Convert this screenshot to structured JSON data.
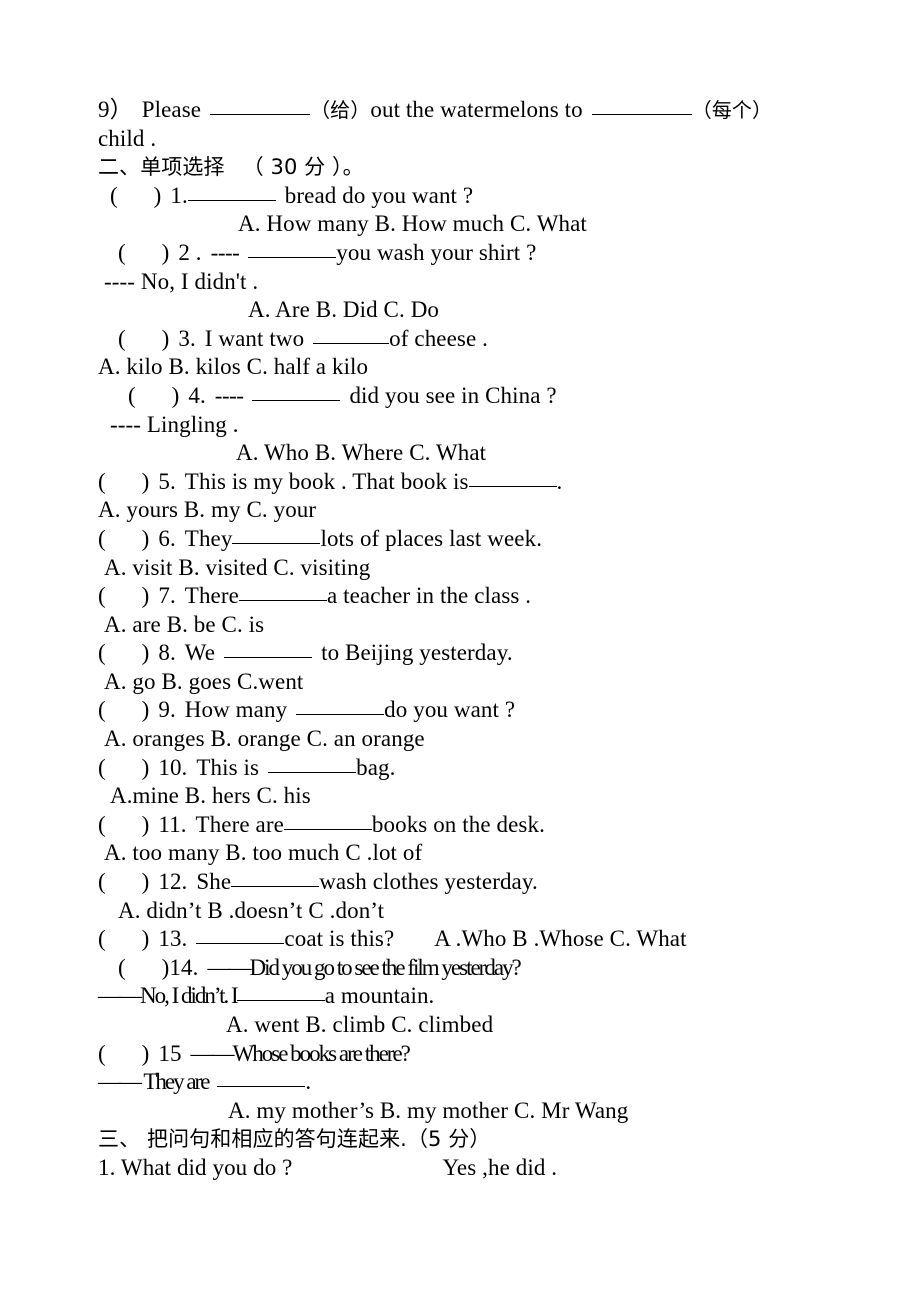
{
  "document": {
    "type": "english-exam-worksheet",
    "language": "en-zh",
    "fill_blank_marker": "__________"
  },
  "carryover_item": {
    "number": "9）",
    "text_1": "Please",
    "hint_1": "（给）",
    "text_2": "out the watermelons to",
    "hint_2": "（每个）",
    "text_3": "child .",
    "line1": "9）Please __________（给）out the watermelons to __________（每个）",
    "line2": "child ."
  },
  "section_two": {
    "heading": "二、单项选择  （ 30 分 ）。",
    "heading_label": "二、单项选择",
    "points": "（ 30 分 ）。",
    "questions": [
      {
        "num": "1.",
        "stem_pre": "",
        "stem_post": "bread  do  you  want ?",
        "options_line": "A.  How  many    B. How  much     C. What",
        "options": [
          "A.  How  many",
          "B. How  much",
          "C. What"
        ]
      },
      {
        "num": "2 .",
        "stem_pre": "----",
        "stem_post": "you  wash  your shirt ?",
        "reply": "---- No,  I  didn't .",
        "options_line": "A.  Are B.  Did    C.  Do",
        "options": [
          "A.  Are",
          "B.  Did",
          "C.  Do"
        ]
      },
      {
        "num": "3.",
        "stem_pre": "I  want  two",
        "stem_post": "of  cheese .",
        "options_line": "A.  kilo  B.  kilos  C.  half a kilo",
        "options": [
          "A.  kilo",
          "B.  kilos",
          "C.  half a kilo"
        ]
      },
      {
        "num": "4.",
        "stem_pre": "----",
        "stem_post": "did  you  see  in  China ?",
        "reply": "---- Lingling .",
        "options_line": "A.  Who      B.  Where      C.  What",
        "options": [
          "A.  Who",
          "B.  Where",
          "C.  What"
        ]
      },
      {
        "num": "5.",
        "stem_pre": "This  is  my  book .  That  book  is",
        "stem_post": ".",
        "options_line": "A. yours B.  my  C.  your",
        "options": [
          "A. yours",
          "B.  my",
          "C.  your"
        ]
      },
      {
        "num": "6.",
        "stem_pre": "They",
        "stem_post": "lots  of  places  last  week.",
        "options_line": "A. visit B.  visited C.  visiting",
        "options": [
          "A. visit",
          "B.  visited",
          "C.  visiting"
        ]
      },
      {
        "num": "7.",
        "stem_pre": "There",
        "stem_post": "a  teacher  in  the  class .",
        "options_line": "A. are  B.  be  C.  is",
        "options": [
          "A. are",
          "B.  be",
          "C.  is"
        ]
      },
      {
        "num": "8.",
        "stem_pre": "We",
        "stem_post": "to Beijing yesterday.",
        "options_line": "A. go   B. goes   C.went",
        "options": [
          "A. go",
          "B. goes",
          "C.went"
        ]
      },
      {
        "num": "9.",
        "stem_pre": "How many",
        "stem_post": "do  you  want ?",
        "options_line": "A. oranges B.   orange C. an   orange",
        "options": [
          "A. oranges",
          "B.   orange",
          "C. an   orange"
        ]
      },
      {
        "num": "10.",
        "stem_pre": "This is",
        "stem_post": "bag.",
        "options_line": "A.mine   B. hers   C. his",
        "options": [
          "A.mine",
          "B. hers",
          "C. his"
        ]
      },
      {
        "num": "11.",
        "stem_pre": "There are",
        "stem_post": "books on the desk.",
        "options_line": "A. too many  B. too much  C .lot of",
        "options": [
          "A. too many",
          "B. too much",
          "C .lot of"
        ]
      },
      {
        "num": "12.",
        "stem_pre": "She",
        "stem_post": "wash clothes yesterday.",
        "options_line": "A. didn’t B .doesn’t C .don’t",
        "options": [
          "A. didn’t",
          "B .doesn’t",
          "C .don’t"
        ]
      },
      {
        "num": "13.",
        "stem_pre": "",
        "stem_post": "coat is this?",
        "inline_options": "A .Who   B .Whose   C. What",
        "options": [
          "A .Who",
          "B .Whose",
          "C. What"
        ]
      },
      {
        "num": ")14.",
        "stem_pre": "——Did you go to see the film yesterday?",
        "reply_pre": "——No, I didn’t. I",
        "reply_post": "a mountain.",
        "options_line": "A. went   B. climb C. climbed",
        "options": [
          "A. went",
          "B. climb",
          "C. climbed"
        ]
      },
      {
        "num": "15",
        "stem_pre": "——Whose books are there?",
        "reply_pre": "—— They are",
        "reply_post": ".",
        "options_line": "A. my mother’s   B. my mother   C. Mr Wang",
        "options": [
          "A. my mother’s",
          "B. my mother",
          "C. Mr Wang"
        ]
      }
    ]
  },
  "section_three": {
    "heading": "三、 把问句和相应的答句连起来.（5 分）",
    "heading_label": "三、 把问句和相应的答句连起来.",
    "points": "（5 分）",
    "rows": [
      {
        "left": "1. What did you do ?",
        "right": "Yes ,he did ."
      }
    ]
  }
}
